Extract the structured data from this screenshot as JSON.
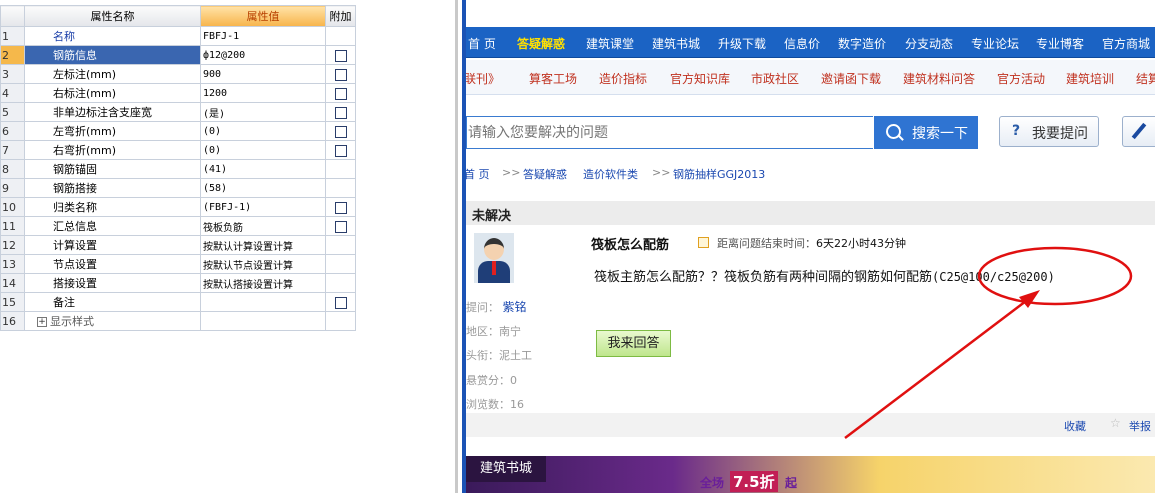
{
  "grid": {
    "headers": {
      "name": "属性名称",
      "value": "属性值",
      "extra": "附加"
    },
    "rows": [
      {
        "idx": "1",
        "name": "名称",
        "value": "FBFJ-1",
        "check": false
      },
      {
        "idx": "2",
        "name": "钢筋信息",
        "value": "ф12@200",
        "check": true
      },
      {
        "idx": "3",
        "name": "左标注(mm)",
        "value": "900",
        "check": true
      },
      {
        "idx": "4",
        "name": "右标注(mm)",
        "value": "1200",
        "check": true
      },
      {
        "idx": "5",
        "name": "非单边标注含支座宽",
        "value": "(是)",
        "check": true
      },
      {
        "idx": "6",
        "name": "左弯折(mm)",
        "value": "(0)",
        "check": true
      },
      {
        "idx": "7",
        "name": "右弯折(mm)",
        "value": "(0)",
        "check": true
      },
      {
        "idx": "8",
        "name": "钢筋锚固",
        "value": "(41)",
        "check": false
      },
      {
        "idx": "9",
        "name": "钢筋搭接",
        "value": "(58)",
        "check": false
      },
      {
        "idx": "10",
        "name": "归类名称",
        "value": "(FBFJ-1)",
        "check": true
      },
      {
        "idx": "11",
        "name": "汇总信息",
        "value": "筏板负筋",
        "check": true
      },
      {
        "idx": "12",
        "name": "计算设置",
        "value": "按默认计算设置计算",
        "check": false
      },
      {
        "idx": "13",
        "name": "节点设置",
        "value": "按默认节点设置计算",
        "check": false
      },
      {
        "idx": "14",
        "name": "搭接设置",
        "value": "按默认搭接设置计算",
        "check": false
      },
      {
        "idx": "15",
        "name": "备注",
        "value": "",
        "check": true
      },
      {
        "idx": "16",
        "name": "显示样式",
        "value": "",
        "check": false,
        "expand": "+"
      }
    ]
  },
  "nav1": [
    "首 页",
    "答疑解惑",
    "建筑课堂",
    "建筑书城",
    "升级下载",
    "信息价",
    "数字造价",
    "分支动态",
    "专业论坛",
    "专业博客",
    "官方商城"
  ],
  "nav2": [
    "联刊》",
    "算客工场",
    "造价指标",
    "官方知识库",
    "市政社区",
    "邀请函下载",
    "建筑材料问答",
    "官方活动",
    "建筑培训",
    "结算"
  ],
  "search": {
    "placeholder": "请输入您要解决的问题",
    "button": "搜索一下"
  },
  "ask_button": "我要提问",
  "ask_icon": "?",
  "breadcrumb": [
    "首 页",
    ">>",
    "答疑解惑",
    "造价软件类",
    ">>",
    "钢筋抽样GGJ2013"
  ],
  "status": "未解决",
  "asker": {
    "label": "提问：",
    "name": "紫铭",
    "region": "地区：南宁",
    "title": "头衔：泥土工",
    "reward": "悬赏分：0",
    "views": "浏览数：16"
  },
  "question": {
    "title": "筏板怎么配筋",
    "deadline_label": "距离问题结束时间：",
    "deadline_value": "6天22小时43分钟",
    "body": "筏板主筋怎么配筋？？筏板负筋有两种间隔的钢筋如何配筋",
    "body_code": "(C25@100/c25@200)"
  },
  "answer_button": "我来回答",
  "footer": {
    "favorite": "收藏",
    "report": "举报",
    "star": "☆"
  },
  "banner": {
    "tag": "建筑书城",
    "all": "全场",
    "discount": "7.5折",
    "qi": "起"
  },
  "colors": {
    "nav_blue": "#1b63c4",
    "annotation_red": "#e01010",
    "selected_row": "#3a66b0",
    "header_orange": "#f7b44a"
  }
}
